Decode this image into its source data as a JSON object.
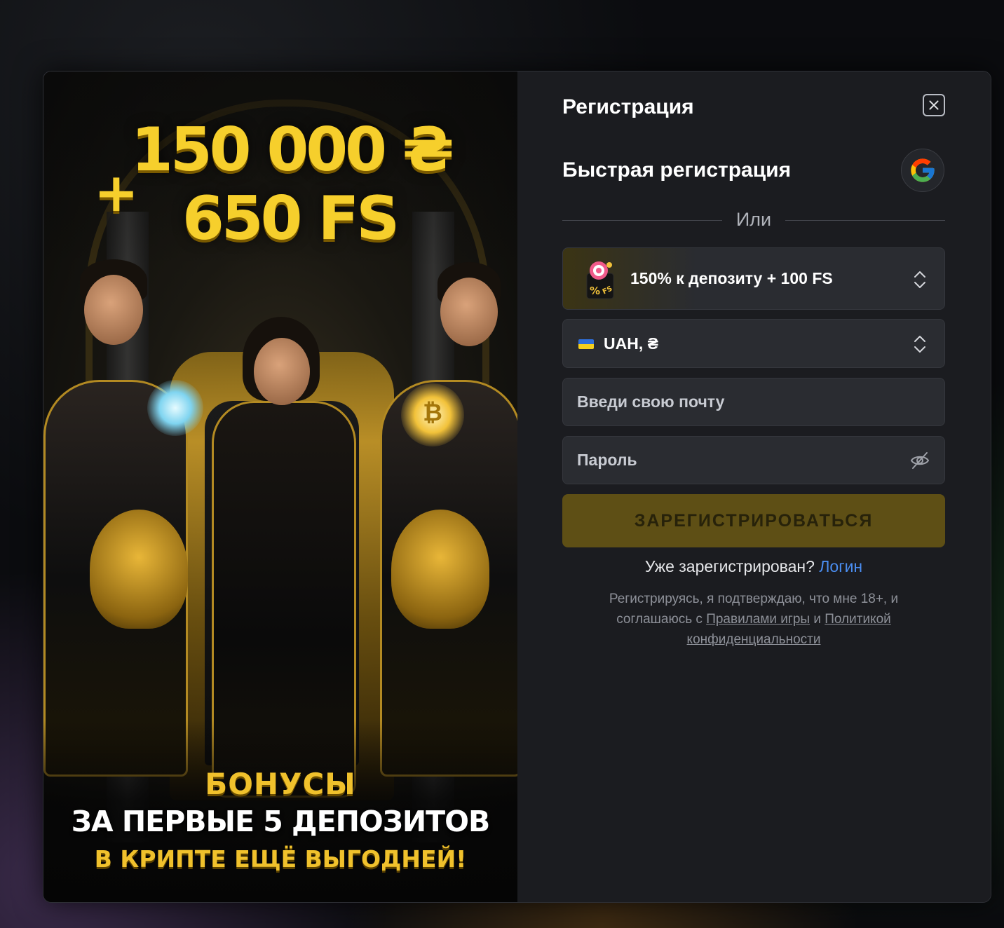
{
  "promo": {
    "plus": "+",
    "amount": "150 000 ₴",
    "free_spins": "650 FS",
    "bonus_line_1": "БОНУСЫ",
    "bonus_line_2": "ЗА ПЕРВЫЕ 5 ДЕПОЗИТОВ",
    "bonus_line_3": "В КРИПТЕ ЕЩЁ ВЫГОДНЕЙ!",
    "orb_symbol": "₿"
  },
  "form": {
    "title": "Регистрация",
    "quick_title": "Быстрая регистрация",
    "or_text": "Или",
    "bonus_select": {
      "label": "150% к депозиту + 100 FS",
      "icon": "bonus-box-icon"
    },
    "currency_select": {
      "label": "UAH, ₴",
      "flag": "ua-flag-icon"
    },
    "email_placeholder": "Введи свою почту",
    "password_placeholder": "Пароль",
    "submit_label": "ЗАРЕГИСТРИРОВАТЬСЯ",
    "already_registered": "Уже зарегистрирован?",
    "login_link": "Логин",
    "terms_prefix": "Регистрируясь, я подтверждаю, что мне 18+, и соглашаюсь с",
    "terms_rules_link": "Правилами игры",
    "terms_and": "и",
    "terms_privacy_link": "Политикой конфиденциальности"
  },
  "colors": {
    "accent_gold": "#f6cf2c",
    "submit_bg": "#5e4f15",
    "link_blue": "#4a8df0",
    "modal_bg": "#1b1c20"
  }
}
